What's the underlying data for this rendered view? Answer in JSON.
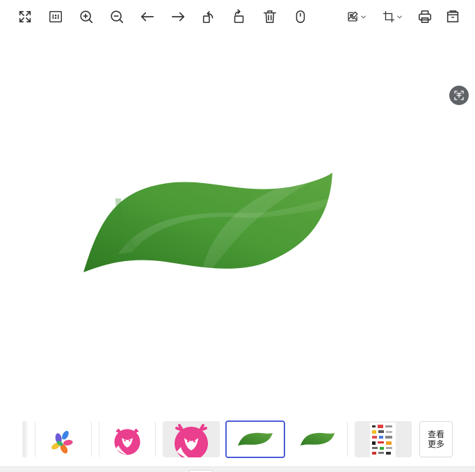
{
  "toolbar": {
    "buttons": [
      {
        "id": "fullscreen",
        "icon": "fullscreen-icon"
      },
      {
        "id": "original-size",
        "icon": "one-to-one-icon"
      },
      {
        "id": "zoom-in",
        "icon": "zoom-in-icon"
      },
      {
        "id": "zoom-out",
        "icon": "zoom-out-icon"
      },
      {
        "id": "previous",
        "icon": "arrow-left-icon"
      },
      {
        "id": "next",
        "icon": "arrow-right-icon"
      },
      {
        "id": "rotate-left",
        "icon": "rotate-left-icon"
      },
      {
        "id": "rotate-right",
        "icon": "rotate-right-icon"
      },
      {
        "id": "delete",
        "icon": "trash-icon"
      },
      {
        "id": "mouse-mode",
        "icon": "mouse-icon"
      }
    ],
    "dropdowns": [
      {
        "id": "image-edit",
        "icon": "image-edit-icon"
      },
      {
        "id": "crop",
        "icon": "crop-icon"
      }
    ],
    "right_buttons": [
      {
        "id": "print",
        "icon": "print-icon"
      },
      {
        "id": "open-folder",
        "icon": "folder-icon"
      }
    ]
  },
  "overlay": {
    "ocr_icon": "text-recognition-icon"
  },
  "main": {
    "image": "green-leaf-image",
    "colors": {
      "leaf_dark": "#2f7a22",
      "leaf_mid": "#4a9a36",
      "leaf_light": "#6fb04f"
    }
  },
  "thumbnails": {
    "items": [
      {
        "id": "thumb-1",
        "content": "partial-image"
      },
      {
        "id": "thumb-2",
        "content": "colorful-pinwheel-logo"
      },
      {
        "id": "thumb-3",
        "content": "pink-deer-logo"
      },
      {
        "id": "thumb-4",
        "content": "pink-deer-logo-large"
      },
      {
        "id": "thumb-5",
        "content": "green-leaf-image",
        "selected": true
      },
      {
        "id": "thumb-6",
        "content": "green-leaf-image"
      },
      {
        "id": "thumb-7",
        "content": "document-collage-image"
      }
    ],
    "more_label": "查看\n更多",
    "selected_border_color": "#4a5cd8"
  }
}
